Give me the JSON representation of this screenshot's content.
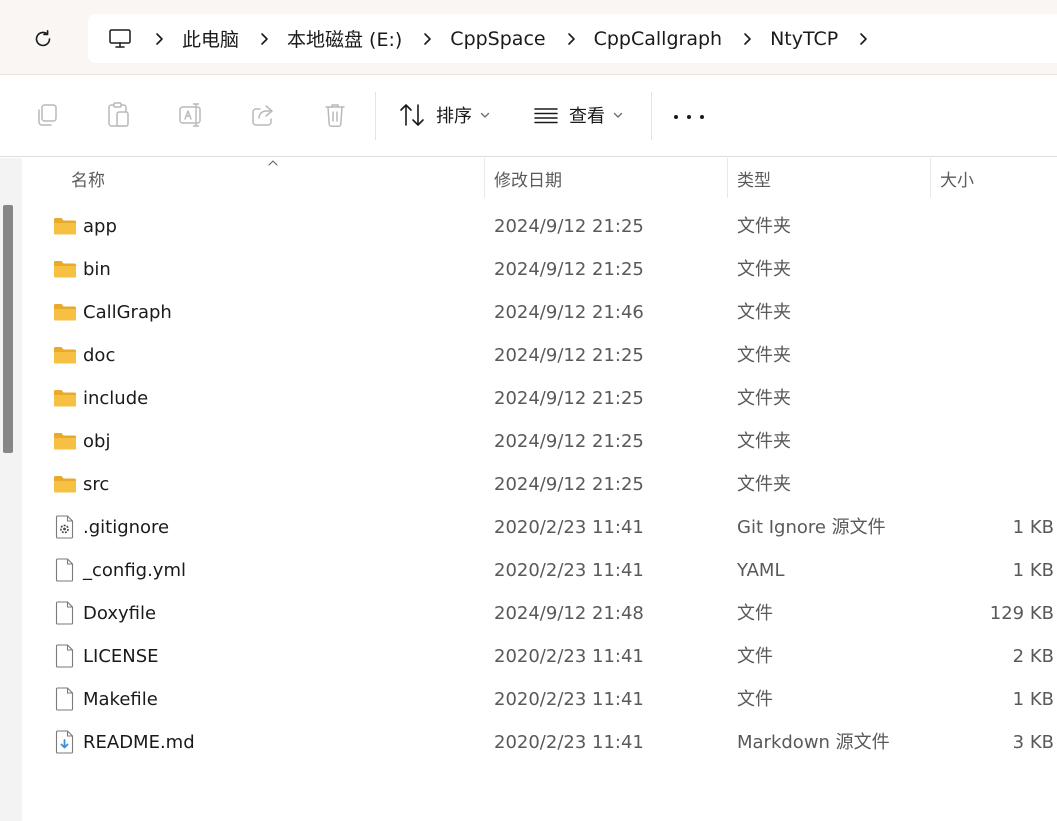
{
  "breadcrumb": {
    "items": [
      "此电脑",
      "本地磁盘 (E:)",
      "CppSpace",
      "CppCallgraph",
      "NtyTCP"
    ]
  },
  "toolbar": {
    "sort_label": "排序",
    "view_label": "查看",
    "icons": [
      "copy-icon",
      "paste-icon",
      "rename-icon",
      "share-icon",
      "delete-icon"
    ]
  },
  "columns": {
    "name": "名称",
    "date": "修改日期",
    "type": "类型",
    "size": "大小"
  },
  "files": [
    {
      "name": "app",
      "date": "2024/9/12 21:25",
      "type": "文件夹",
      "size": "",
      "icon": "folder-icon"
    },
    {
      "name": "bin",
      "date": "2024/9/12 21:25",
      "type": "文件夹",
      "size": "",
      "icon": "folder-icon"
    },
    {
      "name": "CallGraph",
      "date": "2024/9/12 21:46",
      "type": "文件夹",
      "size": "",
      "icon": "folder-icon"
    },
    {
      "name": "doc",
      "date": "2024/9/12 21:25",
      "type": "文件夹",
      "size": "",
      "icon": "folder-icon"
    },
    {
      "name": "include",
      "date": "2024/9/12 21:25",
      "type": "文件夹",
      "size": "",
      "icon": "folder-icon"
    },
    {
      "name": "obj",
      "date": "2024/9/12 21:25",
      "type": "文件夹",
      "size": "",
      "icon": "folder-icon"
    },
    {
      "name": "src",
      "date": "2024/9/12 21:25",
      "type": "文件夹",
      "size": "",
      "icon": "folder-icon"
    },
    {
      "name": ".gitignore",
      "date": "2020/2/23 11:41",
      "type": "Git Ignore 源文件",
      "size": "1 KB",
      "icon": "gear-file-icon"
    },
    {
      "name": "_config.yml",
      "date": "2020/2/23 11:41",
      "type": "YAML",
      "size": "1 KB",
      "icon": "file-icon"
    },
    {
      "name": "Doxyfile",
      "date": "2024/9/12 21:48",
      "type": "文件",
      "size": "129 KB",
      "icon": "file-icon"
    },
    {
      "name": "LICENSE",
      "date": "2020/2/23 11:41",
      "type": "文件",
      "size": "2 KB",
      "icon": "file-icon"
    },
    {
      "name": "Makefile",
      "date": "2020/2/23 11:41",
      "type": "文件",
      "size": "1 KB",
      "icon": "file-icon"
    },
    {
      "name": "README.md",
      "date": "2020/2/23 11:41",
      "type": "Markdown 源文件",
      "size": "3 KB",
      "icon": "markdown-file-icon"
    }
  ],
  "colors": {
    "folder": "#f6c142",
    "folder_dark": "#e9a92a",
    "accent_file_badge": "#3f8fd6",
    "scrollbar": "#868686"
  }
}
